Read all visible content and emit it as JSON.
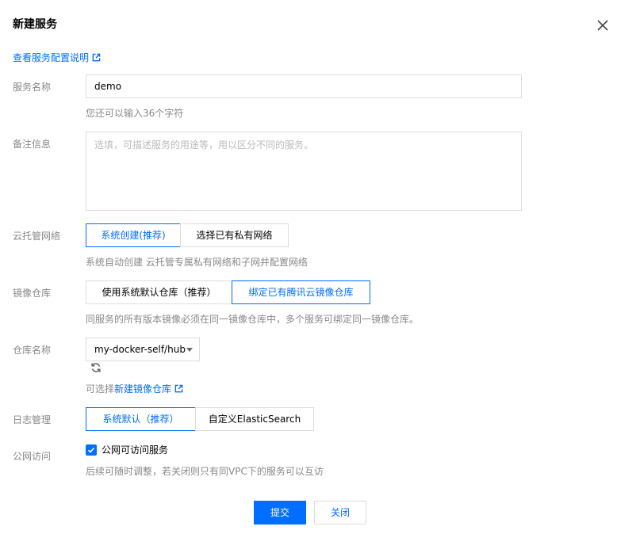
{
  "dialog": {
    "title": "新建服务",
    "doc_link": "查看服务配置说明"
  },
  "service_name": {
    "label": "服务名称",
    "value": "demo",
    "hint": "您还可以输入36个字符"
  },
  "remark": {
    "label": "备注信息",
    "placeholder": "选填，可描述服务的用途等，用以区分不同的服务。"
  },
  "vpc": {
    "label": "云托管网络",
    "options": [
      "系统创建(推荐)",
      "选择已有私有网络"
    ],
    "selected": 0,
    "hint": "系统自动创建 云托管专属私有网络和子网并配置网络"
  },
  "registry": {
    "label": "镜像仓库",
    "options": [
      "使用系统默认仓库（推荐）",
      "绑定已有腾讯云镜像仓库"
    ],
    "selected": 1,
    "hint": "同服务的所有版本镜像必须在同一镜像仓库中，多个服务可绑定同一镜像仓库。"
  },
  "repo_name": {
    "label": "仓库名称",
    "selected": "my-docker-self/hub",
    "hint_prefix": "可选择",
    "hint_link": "新建镜像仓库"
  },
  "log": {
    "label": "日志管理",
    "options": [
      "系统默认（推荐）",
      "自定义ElasticSearch"
    ],
    "selected": 0
  },
  "public_access": {
    "label": "公网访问",
    "checkbox_label": "公网可访问服务",
    "checked": true,
    "hint": "后续可随时调整，若关闭则只有同VPC下的服务可以互访"
  },
  "footer": {
    "submit": "提交",
    "close": "关闭"
  },
  "colors": {
    "primary": "#006eff",
    "border": "#dddddd",
    "muted": "#888888"
  }
}
